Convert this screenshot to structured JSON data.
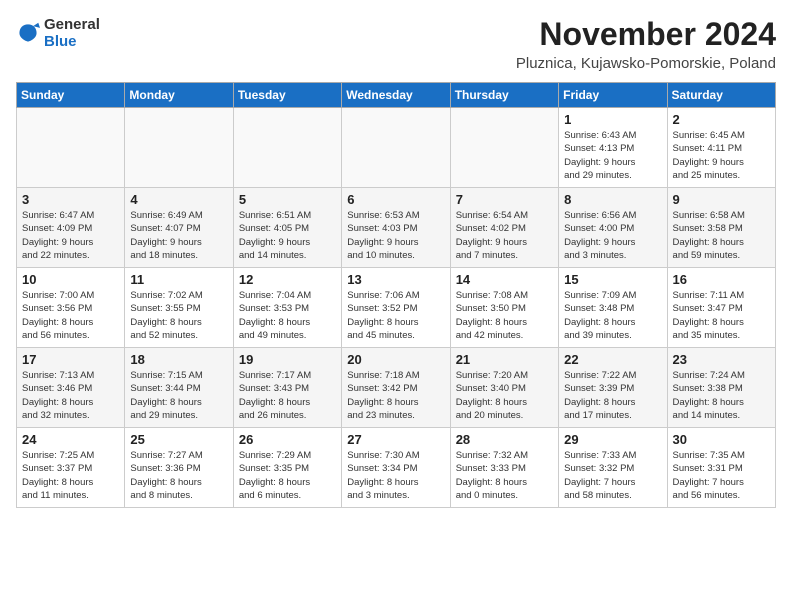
{
  "logo": {
    "general": "General",
    "blue": "Blue"
  },
  "title": "November 2024",
  "subtitle": "Pluznica, Kujawsko-Pomorskie, Poland",
  "weekdays": [
    "Sunday",
    "Monday",
    "Tuesday",
    "Wednesday",
    "Thursday",
    "Friday",
    "Saturday"
  ],
  "weeks": [
    [
      {
        "day": "",
        "detail": ""
      },
      {
        "day": "",
        "detail": ""
      },
      {
        "day": "",
        "detail": ""
      },
      {
        "day": "",
        "detail": ""
      },
      {
        "day": "",
        "detail": ""
      },
      {
        "day": "1",
        "detail": "Sunrise: 6:43 AM\nSunset: 4:13 PM\nDaylight: 9 hours\nand 29 minutes."
      },
      {
        "day": "2",
        "detail": "Sunrise: 6:45 AM\nSunset: 4:11 PM\nDaylight: 9 hours\nand 25 minutes."
      }
    ],
    [
      {
        "day": "3",
        "detail": "Sunrise: 6:47 AM\nSunset: 4:09 PM\nDaylight: 9 hours\nand 22 minutes."
      },
      {
        "day": "4",
        "detail": "Sunrise: 6:49 AM\nSunset: 4:07 PM\nDaylight: 9 hours\nand 18 minutes."
      },
      {
        "day": "5",
        "detail": "Sunrise: 6:51 AM\nSunset: 4:05 PM\nDaylight: 9 hours\nand 14 minutes."
      },
      {
        "day": "6",
        "detail": "Sunrise: 6:53 AM\nSunset: 4:03 PM\nDaylight: 9 hours\nand 10 minutes."
      },
      {
        "day": "7",
        "detail": "Sunrise: 6:54 AM\nSunset: 4:02 PM\nDaylight: 9 hours\nand 7 minutes."
      },
      {
        "day": "8",
        "detail": "Sunrise: 6:56 AM\nSunset: 4:00 PM\nDaylight: 9 hours\nand 3 minutes."
      },
      {
        "day": "9",
        "detail": "Sunrise: 6:58 AM\nSunset: 3:58 PM\nDaylight: 8 hours\nand 59 minutes."
      }
    ],
    [
      {
        "day": "10",
        "detail": "Sunrise: 7:00 AM\nSunset: 3:56 PM\nDaylight: 8 hours\nand 56 minutes."
      },
      {
        "day": "11",
        "detail": "Sunrise: 7:02 AM\nSunset: 3:55 PM\nDaylight: 8 hours\nand 52 minutes."
      },
      {
        "day": "12",
        "detail": "Sunrise: 7:04 AM\nSunset: 3:53 PM\nDaylight: 8 hours\nand 49 minutes."
      },
      {
        "day": "13",
        "detail": "Sunrise: 7:06 AM\nSunset: 3:52 PM\nDaylight: 8 hours\nand 45 minutes."
      },
      {
        "day": "14",
        "detail": "Sunrise: 7:08 AM\nSunset: 3:50 PM\nDaylight: 8 hours\nand 42 minutes."
      },
      {
        "day": "15",
        "detail": "Sunrise: 7:09 AM\nSunset: 3:48 PM\nDaylight: 8 hours\nand 39 minutes."
      },
      {
        "day": "16",
        "detail": "Sunrise: 7:11 AM\nSunset: 3:47 PM\nDaylight: 8 hours\nand 35 minutes."
      }
    ],
    [
      {
        "day": "17",
        "detail": "Sunrise: 7:13 AM\nSunset: 3:46 PM\nDaylight: 8 hours\nand 32 minutes."
      },
      {
        "day": "18",
        "detail": "Sunrise: 7:15 AM\nSunset: 3:44 PM\nDaylight: 8 hours\nand 29 minutes."
      },
      {
        "day": "19",
        "detail": "Sunrise: 7:17 AM\nSunset: 3:43 PM\nDaylight: 8 hours\nand 26 minutes."
      },
      {
        "day": "20",
        "detail": "Sunrise: 7:18 AM\nSunset: 3:42 PM\nDaylight: 8 hours\nand 23 minutes."
      },
      {
        "day": "21",
        "detail": "Sunrise: 7:20 AM\nSunset: 3:40 PM\nDaylight: 8 hours\nand 20 minutes."
      },
      {
        "day": "22",
        "detail": "Sunrise: 7:22 AM\nSunset: 3:39 PM\nDaylight: 8 hours\nand 17 minutes."
      },
      {
        "day": "23",
        "detail": "Sunrise: 7:24 AM\nSunset: 3:38 PM\nDaylight: 8 hours\nand 14 minutes."
      }
    ],
    [
      {
        "day": "24",
        "detail": "Sunrise: 7:25 AM\nSunset: 3:37 PM\nDaylight: 8 hours\nand 11 minutes."
      },
      {
        "day": "25",
        "detail": "Sunrise: 7:27 AM\nSunset: 3:36 PM\nDaylight: 8 hours\nand 8 minutes."
      },
      {
        "day": "26",
        "detail": "Sunrise: 7:29 AM\nSunset: 3:35 PM\nDaylight: 8 hours\nand 6 minutes."
      },
      {
        "day": "27",
        "detail": "Sunrise: 7:30 AM\nSunset: 3:34 PM\nDaylight: 8 hours\nand 3 minutes."
      },
      {
        "day": "28",
        "detail": "Sunrise: 7:32 AM\nSunset: 3:33 PM\nDaylight: 8 hours\nand 0 minutes."
      },
      {
        "day": "29",
        "detail": "Sunrise: 7:33 AM\nSunset: 3:32 PM\nDaylight: 7 hours\nand 58 minutes."
      },
      {
        "day": "30",
        "detail": "Sunrise: 7:35 AM\nSunset: 3:31 PM\nDaylight: 7 hours\nand 56 minutes."
      }
    ]
  ]
}
